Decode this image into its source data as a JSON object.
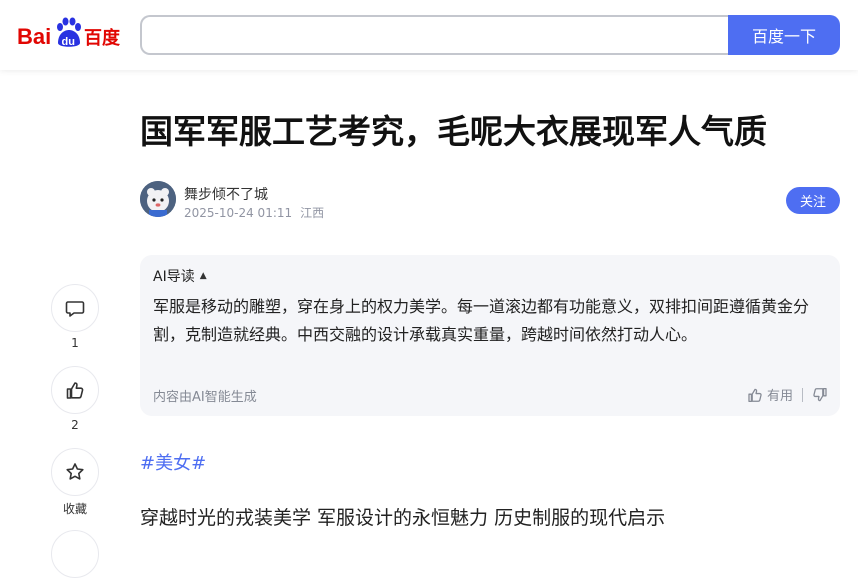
{
  "header": {
    "logo_text": "Bai du 百度",
    "search_value": "",
    "search_button": "百度一下"
  },
  "article": {
    "title": "国军军服工艺考究，毛呢大衣展现军人气质",
    "author": {
      "name": "舞步倾不了城",
      "datetime": "2025-10-24 01:11",
      "location": "江西",
      "follow_label": "关注"
    },
    "ai_summary": {
      "heading": "AI导读",
      "text": "军服是移动的雕塑，穿在身上的权力美学。每一道滚边都有功能意义，双排扣间距遵循黄金分割，克制造就经典。中西交融的设计承载真实重量，跨越时间依然打动人心。",
      "footnote": "内容由AI智能生成",
      "useful_label": "有用"
    },
    "hashtag": "#美女#",
    "body_first_line": "穿越时光的戎装美学 军服设计的永恒魅力 历史制服的现代启示"
  },
  "rail": {
    "comment_count": "1",
    "like_count": "2",
    "favorite_label": "收藏"
  },
  "icons": {
    "comment": "comment-icon",
    "like": "thumbs-up-icon",
    "favorite": "star-icon",
    "useful": "thumbs-up-icon",
    "useless": "thumbs-down-icon"
  },
  "colors": {
    "brand_blue": "#4e6ef2",
    "baidu_red": "#e10602",
    "baidu_blue": "#2932e1"
  }
}
